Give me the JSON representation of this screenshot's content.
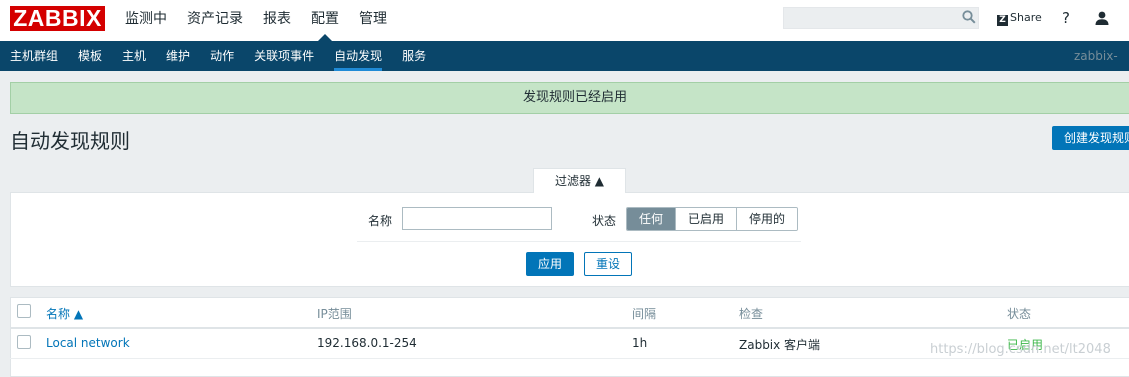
{
  "header": {
    "logo": "ZABBIX",
    "menu": [
      "监测中",
      "资产记录",
      "报表",
      "配置",
      "管理"
    ],
    "active_menu": "配置",
    "search_placeholder": "",
    "share_label": "Share",
    "help_label": "?"
  },
  "subnav": {
    "items": [
      "主机群组",
      "模板",
      "主机",
      "维护",
      "动作",
      "关联项事件",
      "自动发现",
      "服务"
    ],
    "active": "自动发现",
    "server_label": "zabbix-se"
  },
  "message": "发现规则已经启用",
  "page": {
    "title": "自动发现规则",
    "create_button": "创建发现规则"
  },
  "filter": {
    "tab_label": "过滤器 ▲",
    "name_label": "名称",
    "name_value": "",
    "status_label": "状态",
    "status_options": [
      "任何",
      "已启用",
      "停用的"
    ],
    "status_selected": "任何",
    "apply_label": "应用",
    "reset_label": "重设"
  },
  "table": {
    "columns": [
      "名称 ▲",
      "IP范围",
      "间隔",
      "检查",
      "状态"
    ],
    "rows": [
      {
        "name": "Local network",
        "ip_range": "192.168.0.1-254",
        "interval": "1h",
        "checks": "Zabbix 客户端",
        "status": "已启用"
      }
    ]
  },
  "watermark": "https://blog.csdn.net/lt2048",
  "colors": {
    "brand": "#d40000",
    "nav": "#0a466a",
    "primary": "#0275b8",
    "success_bg": "#c5e4c7",
    "enabled": "#3db74a"
  }
}
